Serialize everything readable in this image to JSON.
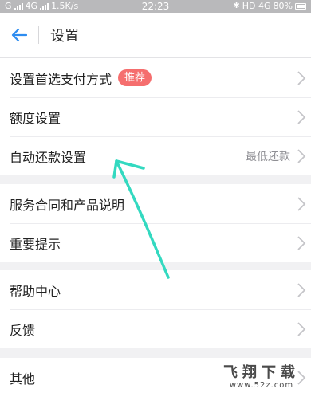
{
  "status_bar": {
    "left": "G",
    "carrier": "4G",
    "net_speed": "1.5K/s",
    "time": "22:23",
    "right": "HD 4G",
    "battery": "80%"
  },
  "nav": {
    "title": "设置",
    "back_icon": "back-arrow-icon"
  },
  "groups": [
    {
      "rows": [
        {
          "label": "设置首选支付方式",
          "badge": "推荐",
          "value": ""
        },
        {
          "label": "额度设置",
          "badge": "",
          "value": ""
        },
        {
          "label": "自动还款设置",
          "badge": "",
          "value": "最低还款"
        }
      ]
    },
    {
      "rows": [
        {
          "label": "服务合同和产品说明",
          "badge": "",
          "value": ""
        },
        {
          "label": "重要提示",
          "badge": "",
          "value": ""
        }
      ]
    },
    {
      "rows": [
        {
          "label": "帮助中心",
          "badge": "",
          "value": ""
        },
        {
          "label": "反馈",
          "badge": "",
          "value": ""
        }
      ]
    },
    {
      "rows": [
        {
          "label": "其他",
          "badge": "",
          "value": ""
        }
      ]
    }
  ],
  "colors": {
    "accent": "#2d8cf0",
    "badge": "#f56e6e",
    "annotation_arrow": "#33d9c0"
  },
  "watermark": {
    "main": "飞翔下载",
    "sub": "www.52z.com"
  }
}
